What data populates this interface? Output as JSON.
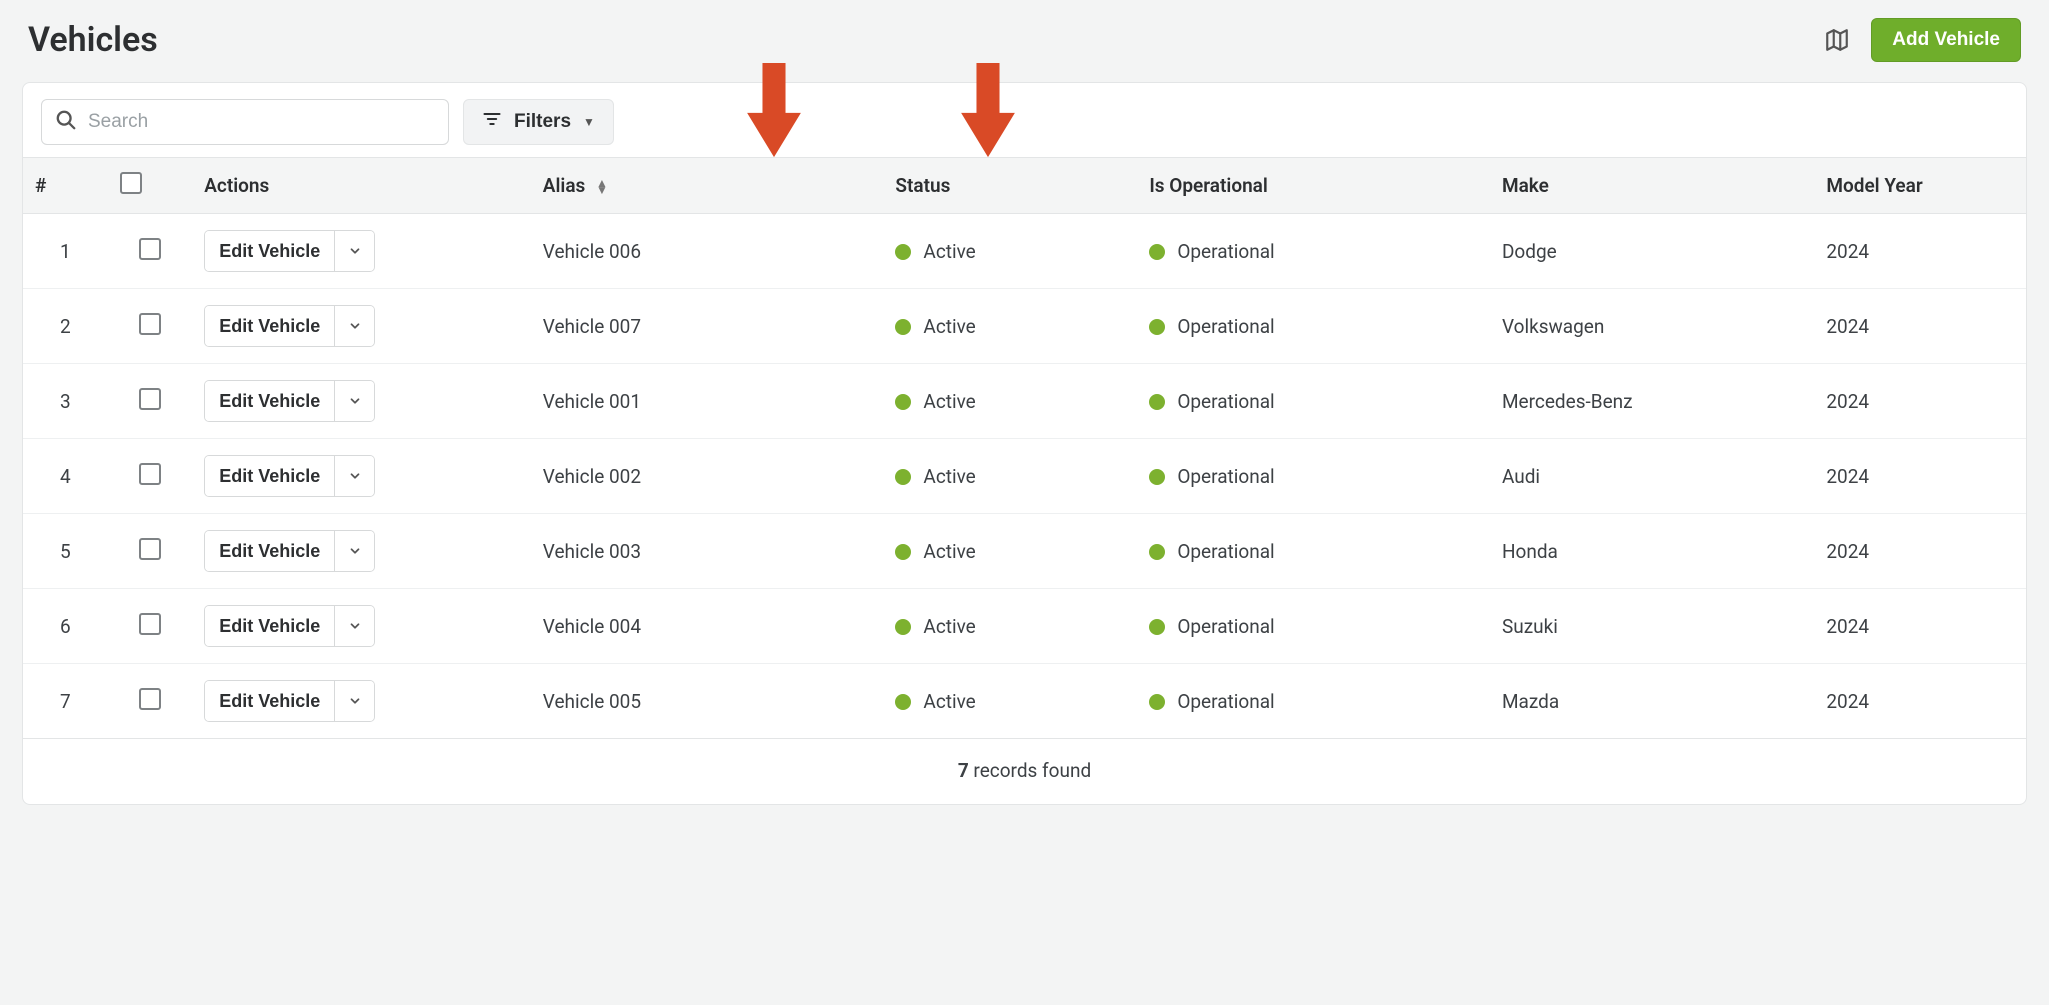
{
  "page": {
    "title": "Vehicles",
    "add_button": "Add Vehicle"
  },
  "toolbar": {
    "search_placeholder": "Search",
    "filters_label": "Filters"
  },
  "columns": {
    "num": "#",
    "actions": "Actions",
    "alias": "Alias",
    "status": "Status",
    "is_operational": "Is Operational",
    "make": "Make",
    "model_year": "Model Year"
  },
  "action_button_label": "Edit Vehicle",
  "rows": [
    {
      "num": "1",
      "alias": "Vehicle 006",
      "status": "Active",
      "operational": "Operational",
      "make": "Dodge",
      "year": "2024"
    },
    {
      "num": "2",
      "alias": "Vehicle 007",
      "status": "Active",
      "operational": "Operational",
      "make": "Volkswagen",
      "year": "2024"
    },
    {
      "num": "3",
      "alias": "Vehicle 001",
      "status": "Active",
      "operational": "Operational",
      "make": "Mercedes-Benz",
      "year": "2024"
    },
    {
      "num": "4",
      "alias": "Vehicle 002",
      "status": "Active",
      "operational": "Operational",
      "make": "Audi",
      "year": "2024"
    },
    {
      "num": "5",
      "alias": "Vehicle 003",
      "status": "Active",
      "operational": "Operational",
      "make": "Honda",
      "year": "2024"
    },
    {
      "num": "6",
      "alias": "Vehicle 004",
      "status": "Active",
      "operational": "Operational",
      "make": "Suzuki",
      "year": "2024"
    },
    {
      "num": "7",
      "alias": "Vehicle 005",
      "status": "Active",
      "operational": "Operational",
      "make": "Mazda",
      "year": "2024"
    }
  ],
  "footer": {
    "count": "7",
    "records_found": " records found"
  },
  "colors": {
    "primary_green": "#6fae2b",
    "status_dot": "#7db12f",
    "arrow_red": "#d94a26"
  }
}
